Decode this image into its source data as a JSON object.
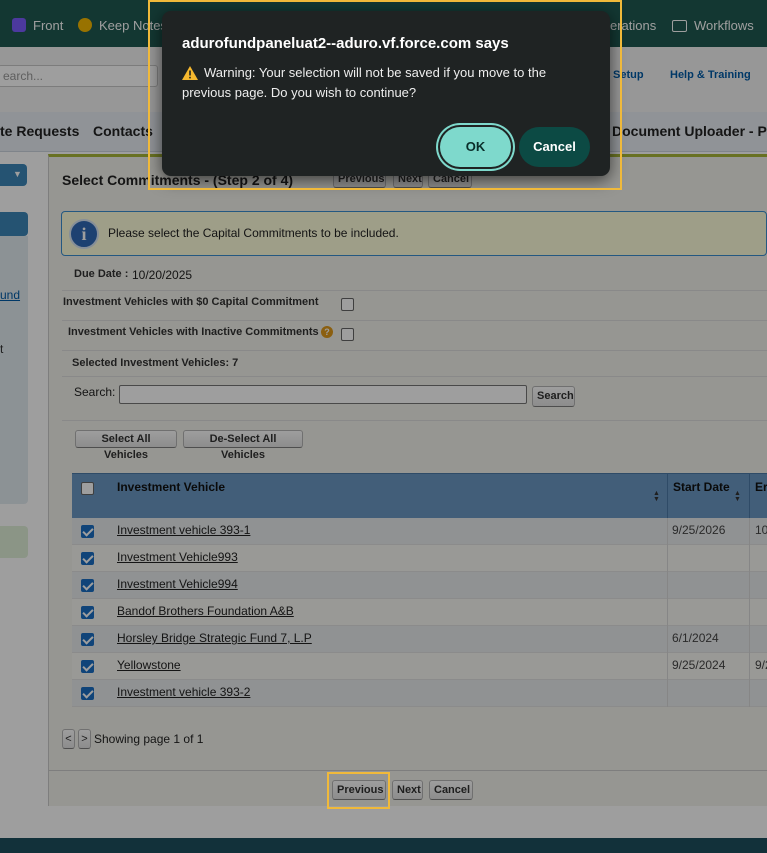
{
  "bookmarks": [
    {
      "label": "Front",
      "color": "#7b5cff"
    },
    {
      "label": "Keep Notes",
      "color": "#f6b900"
    },
    {
      "label": "erations"
    },
    {
      "label": "Workflows"
    }
  ],
  "header": {
    "search_placeholder": "earch...",
    "setup": "Setup",
    "help": "Help & Training"
  },
  "tabs": [
    "te Requests",
    "Contacts",
    "Document Uploader - Por"
  ],
  "left": {
    "link1": "und",
    "link2": "t"
  },
  "page": {
    "title": "Select Commitments - (Step 2 of 4)",
    "top_buttons": {
      "previous": "Previous",
      "next": "Next",
      "cancel": "Cancel"
    },
    "info_message": "Please select the Capital Commitments to be included.",
    "due_date_label": "Due Date :",
    "due_date_value": "10/20/2025",
    "zero_commitment_label": "Investment Vehicles with $0 Capital Commitment",
    "inactive_label": "Investment Vehicles with Inactive Commitments",
    "selected_label": "Selected Investment Vehicles: 7",
    "search_label": "Search:",
    "search_value": "",
    "search_button": "Search",
    "select_all": "Select All Vehicles",
    "deselect_all": "De-Select All Vehicles",
    "columns": {
      "vehicle": "Investment Vehicle",
      "start": "Start Date",
      "end": "Er"
    },
    "rows": [
      {
        "name": "Investment vehicle 393-1",
        "start": "9/25/2026",
        "end": "10",
        "checked": true
      },
      {
        "name": "Investment Vehicle993",
        "start": "",
        "end": "",
        "checked": true
      },
      {
        "name": "Investment Vehicle994",
        "start": "",
        "end": "",
        "checked": true
      },
      {
        "name": "Bandof Brothers Foundation A&B",
        "start": "",
        "end": "",
        "checked": true
      },
      {
        "name": "Horsley Bridge Strategic Fund 7, L.P",
        "start": "6/1/2024",
        "end": "",
        "checked": true
      },
      {
        "name": "Yellowstone",
        "start": "9/25/2024",
        "end": "9/2",
        "checked": true
      },
      {
        "name": "Investment vehicle 393-2",
        "start": "",
        "end": "",
        "checked": true
      }
    ],
    "pager_prev": "<",
    "pager_next": ">",
    "pager_text": "Showing page 1 of 1",
    "bottom_buttons": {
      "previous": "Previous",
      "next": "Next",
      "cancel": "Cancel"
    }
  },
  "dialog": {
    "title": "adurofundpaneluat2--aduro.vf.force.com says",
    "warning_icon": "warning-icon",
    "message_line1": "Warning: Your selection will not be saved if you move to the",
    "message_line2": "previous page. Do you wish to continue?",
    "ok": "OK",
    "cancel": "Cancel"
  }
}
